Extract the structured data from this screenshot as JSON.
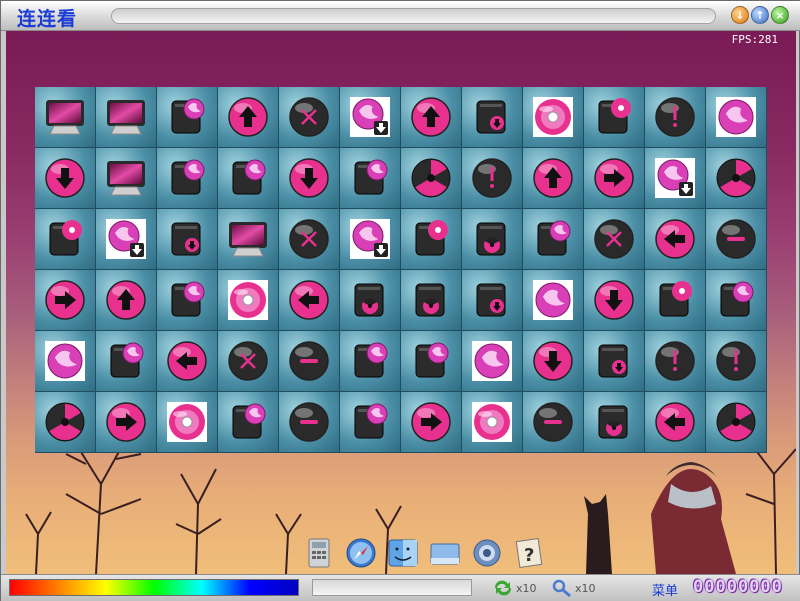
{
  "window": {
    "title": "连连看"
  },
  "hud": {
    "fps": "FPS:281"
  },
  "board": {
    "rows": 6,
    "cols": 12,
    "tiles": [
      [
        "monitor",
        "monitor",
        "disk-globe",
        "up",
        "x",
        "globe-down",
        "up",
        "disk-down",
        "cd",
        "disk-cd",
        "excl",
        "globe"
      ],
      [
        "down",
        "monitor",
        "disk-globe",
        "disk-globe",
        "down",
        "disk-globe",
        "radiation",
        "excl",
        "up",
        "right",
        "globe-down",
        "radiation"
      ],
      [
        "disk-cd",
        "globe-down",
        "disk-down",
        "monitor",
        "x",
        "globe-down",
        "disk-cd",
        "disk-radiation",
        "disk-globe",
        "x",
        "left",
        "minus"
      ],
      [
        "right",
        "up",
        "disk-globe",
        "cd",
        "left",
        "disk-radiation",
        "disk-radiation",
        "disk-down",
        "globe",
        "down",
        "disk-cd",
        "disk-globe"
      ],
      [
        "globe",
        "disk-globe",
        "left",
        "x",
        "minus",
        "disk-globe",
        "disk-globe",
        "globe",
        "down",
        "disk-down",
        "excl",
        "excl"
      ],
      [
        "radiation",
        "right",
        "cd",
        "disk-globe",
        "minus",
        "disk-globe",
        "right",
        "cd",
        "minus",
        "disk-radiation",
        "left",
        "radiation"
      ]
    ]
  },
  "dock": {
    "items": [
      {
        "name": "calculator-icon"
      },
      {
        "name": "safari-icon"
      },
      {
        "name": "finder-icon"
      },
      {
        "name": "drive-icon"
      },
      {
        "name": "settings-gear-icon"
      },
      {
        "name": "help-icon"
      }
    ]
  },
  "status": {
    "refresh_count": "x10",
    "hint_count": "x10",
    "menu_label": "菜单",
    "score": "00000000"
  },
  "colors": {
    "accent": "#e8308f",
    "title": "#1a3bd6"
  }
}
